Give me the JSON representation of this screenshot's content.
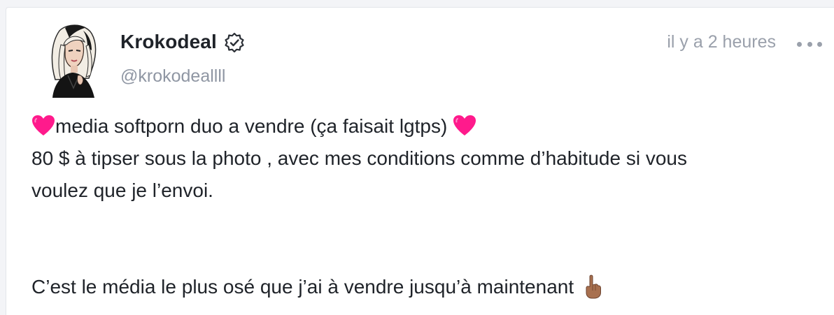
{
  "post": {
    "author": {
      "display_name": "Krokodeal",
      "handle": "@krokodeallll",
      "verified": true,
      "avatar_icon": "avatar-illustration"
    },
    "timestamp": "il y a 2 heures",
    "menu_icon": "more-horizontal-icon",
    "body": {
      "line1_text": "media softporn duo a vendre (ça faisait lgtps) ",
      "line1_emoji_start": "pink-heart-emoji",
      "line1_emoji_end": "pink-heart-emoji",
      "line2": "80 $ à tipser sous la photo , avec mes conditions comme d’habitude si vous",
      "line3": "voulez que je l’envoi.",
      "line4_text": "C’est le média le plus osé que j’ai à vendre jusqu’à maintenant ",
      "line4_emoji": "index-pointing-up-emoji"
    }
  },
  "colors": {
    "background": "#f3f4f7",
    "card": "#ffffff",
    "text_primary": "#1f2329",
    "text_secondary": "#8f96a3",
    "heart": "#ff1a8c"
  }
}
